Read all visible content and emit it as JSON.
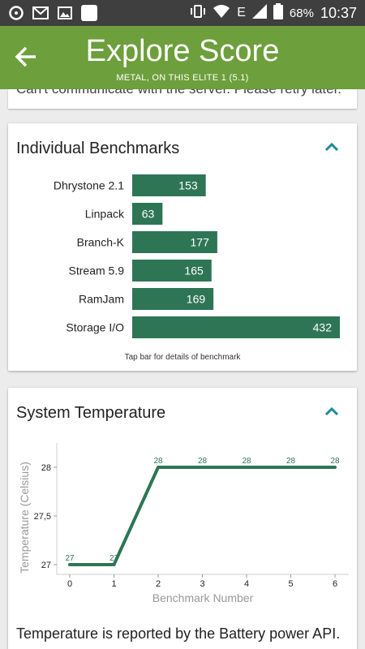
{
  "status_bar": {
    "battery_percent": "68%",
    "time": "10:37",
    "network_type": "E"
  },
  "app_bar": {
    "title": "Explore Score",
    "subtitle": "METAL, ON THIS ELITE 1 (5.1)"
  },
  "error_banner": {
    "text": "Can't communicate with the server. Please retry later."
  },
  "benchmarks_card": {
    "title": "Individual Benchmarks",
    "hint": "Tap bar for details of benchmark",
    "bar_color": "#2e7556"
  },
  "temperature_card": {
    "title": "System Temperature",
    "footnote": "Temperature is reported by the Battery power API.",
    "line_color": "#2e7556",
    "accent_color": "#1c8a9a"
  },
  "chart_data": [
    {
      "type": "bar",
      "orientation": "horizontal",
      "categories": [
        "Dhrystone 2.1",
        "Linpack",
        "Branch-K",
        "Stream 5.9",
        "RamJam",
        "Storage I/O"
      ],
      "values": [
        153,
        63,
        177,
        165,
        169,
        432
      ],
      "title": "Individual Benchmarks",
      "xlim": [
        0,
        432
      ]
    },
    {
      "type": "line",
      "title": "System Temperature",
      "xlabel": "Benchmark Number",
      "ylabel": "Temperature (Celsius)",
      "x": [
        0,
        1,
        2,
        3,
        4,
        5,
        6
      ],
      "y": [
        27,
        27,
        28,
        28,
        28,
        28,
        28
      ],
      "point_labels": [
        "27",
        "27",
        "28",
        "28",
        "28",
        "28",
        "28"
      ],
      "x_ticks": [
        "0",
        "1",
        "2",
        "3",
        "4",
        "5",
        "6"
      ],
      "y_ticks": [
        "27",
        "27,5",
        "28"
      ],
      "ylim": [
        27,
        28
      ],
      "xlim": [
        0,
        6
      ]
    }
  ]
}
